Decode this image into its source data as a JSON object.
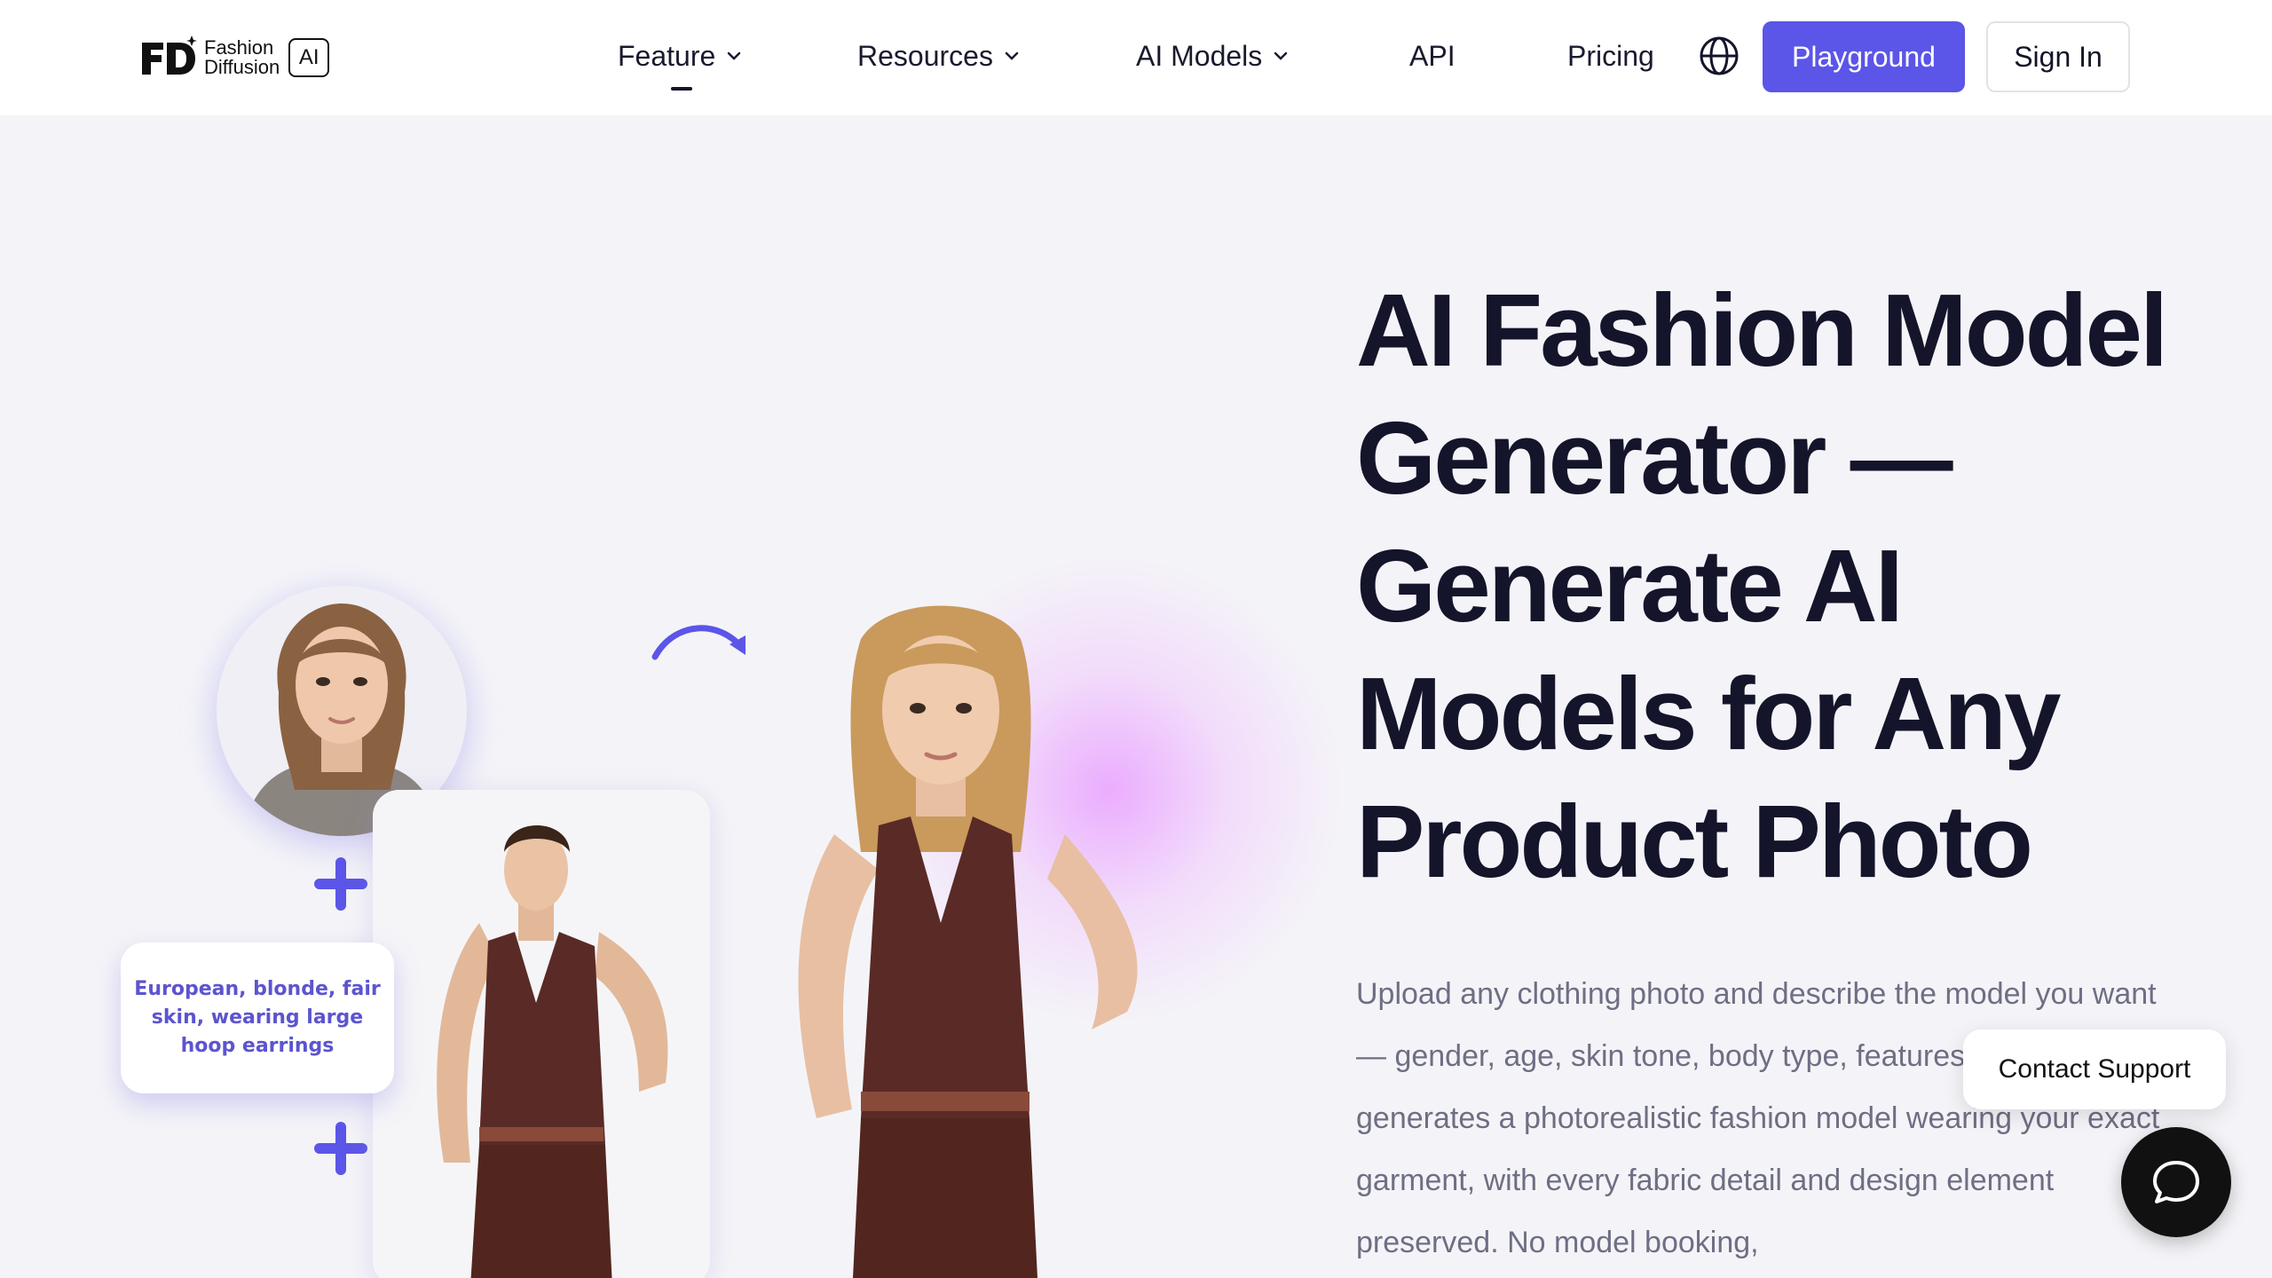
{
  "brand": {
    "line1": "Fashion",
    "line2": "Diffusion",
    "badge": "AI"
  },
  "nav": {
    "items": [
      {
        "label": "Feature",
        "has_dropdown": true,
        "active": true
      },
      {
        "label": "Resources",
        "has_dropdown": true
      },
      {
        "label": "AI Models",
        "has_dropdown": true
      },
      {
        "label": "API",
        "has_dropdown": false
      },
      {
        "label": "Pricing",
        "has_dropdown": false
      }
    ],
    "language_icon": "globe-icon",
    "playground_label": "Playground",
    "signin_label": "Sign In"
  },
  "hero": {
    "title": "AI Fashion Model Generator — Generate AI Models for Any Product Photo",
    "description": "Upload any clothing photo and describe the model you want — gender, age, skin tone, body type, features. The AI generates a photorealistic fashion model wearing your exact garment, with every fabric detail and design element preserved. No model booking,",
    "prompt_example": "European, blonde, fair skin, wearing large hoop earrings"
  },
  "support": {
    "label": "Contact Support",
    "icon": "chat-icon"
  },
  "colors": {
    "accent": "#5b55e8",
    "title": "#14142b",
    "body_text": "#6e6e84",
    "background": "#f4f4f8",
    "garment": "#5a2a26"
  }
}
